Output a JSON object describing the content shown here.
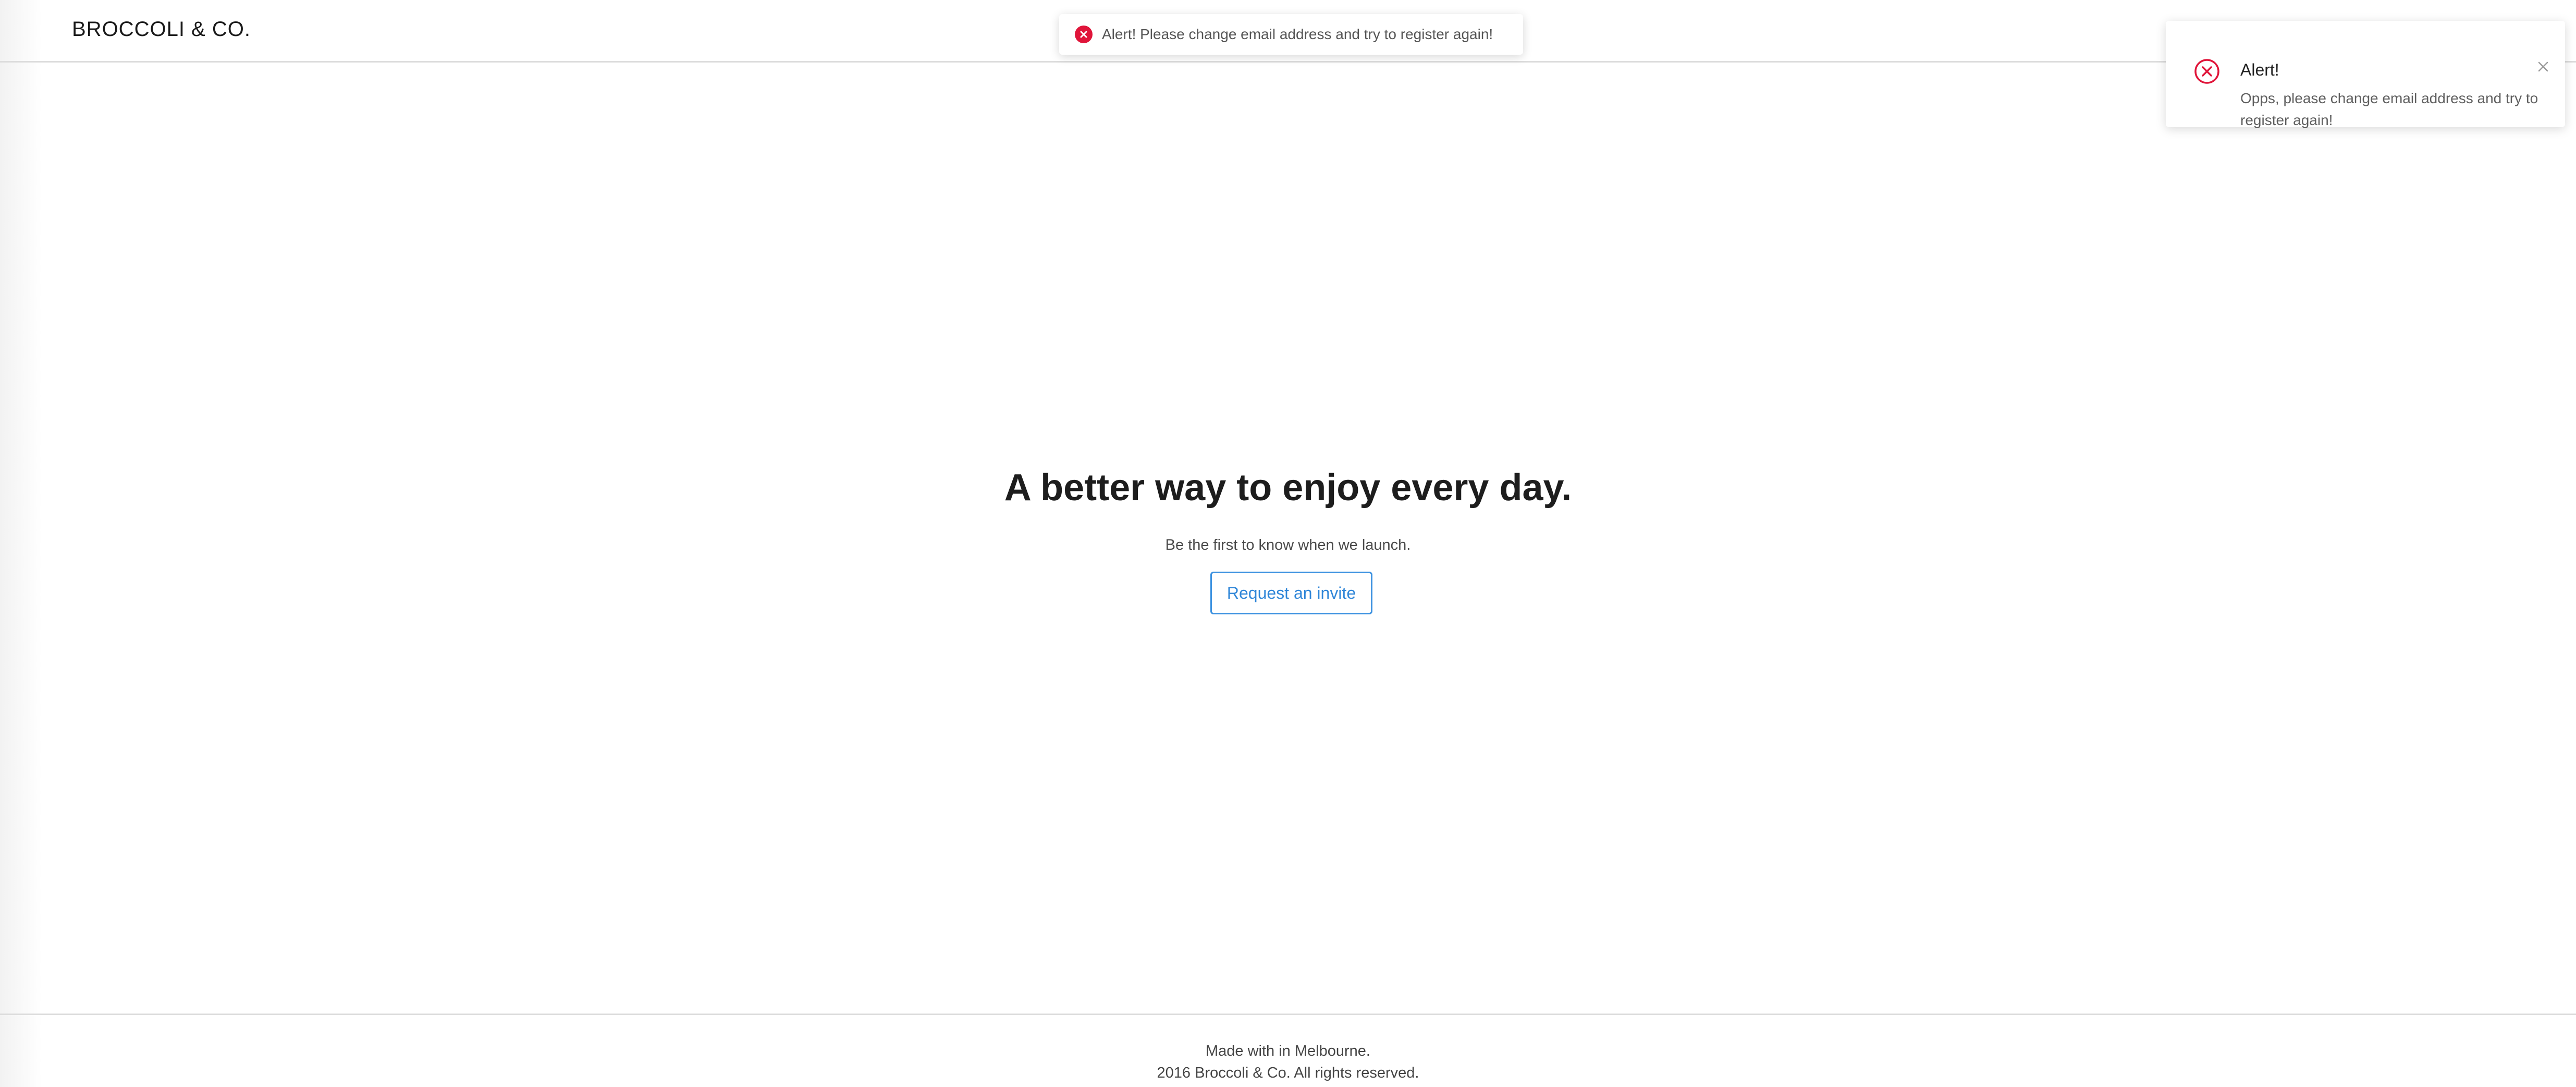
{
  "header": {
    "brand": "BROCCOLI & CO."
  },
  "toast": {
    "message": "Alert! Please change email address and try to register again!",
    "icon": "error-circle-icon",
    "color": "#e0153a"
  },
  "notification": {
    "title": "Alert!",
    "body": "Opps, please change email address and try to register again!",
    "icon": "error-circle-outline-icon",
    "close_icon": "close-icon",
    "color": "#e0153a"
  },
  "hero": {
    "title": "A better way to enjoy every day.",
    "subtitle": "Be the first to know when we launch.",
    "button_label": "Request an invite",
    "button_color": "#3d92e0"
  },
  "footer": {
    "line1": "Made with in Melbourne.",
    "line2": "2016 Broccoli & Co. All rights reserved."
  }
}
